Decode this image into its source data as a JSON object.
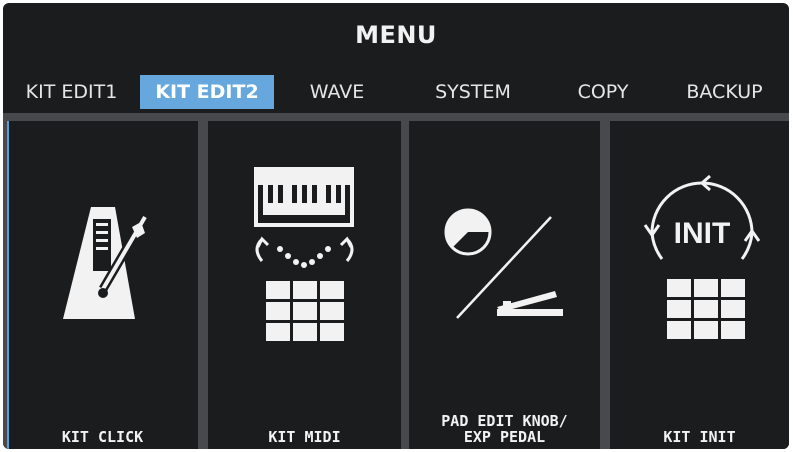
{
  "header": {
    "title": "MENU"
  },
  "tabs": [
    {
      "label": "KIT EDIT1",
      "active": false
    },
    {
      "label": "KIT EDIT2",
      "active": true
    },
    {
      "label": "WAVE",
      "active": false
    },
    {
      "label": "SYSTEM",
      "active": false
    },
    {
      "label": "COPY",
      "active": false
    },
    {
      "label": "BACKUP",
      "active": false
    }
  ],
  "tiles": [
    {
      "label": "KIT CLICK",
      "icon": "metronome-icon"
    },
    {
      "label": "KIT MIDI",
      "icon": "midi-keyboard-pads-icon"
    },
    {
      "label_line1": "PAD EDIT KNOB/",
      "label_line2": "EXP PEDAL",
      "icon": "knob-pedal-icon"
    },
    {
      "label": "KIT INIT",
      "icon": "init-pads-icon",
      "icon_text": "INIT"
    }
  ],
  "colors": {
    "screen_bg": "#1b1c1e",
    "active_tab": "#66a8dd",
    "tile_gap": "#47494d",
    "text": "#f2f2f2"
  }
}
